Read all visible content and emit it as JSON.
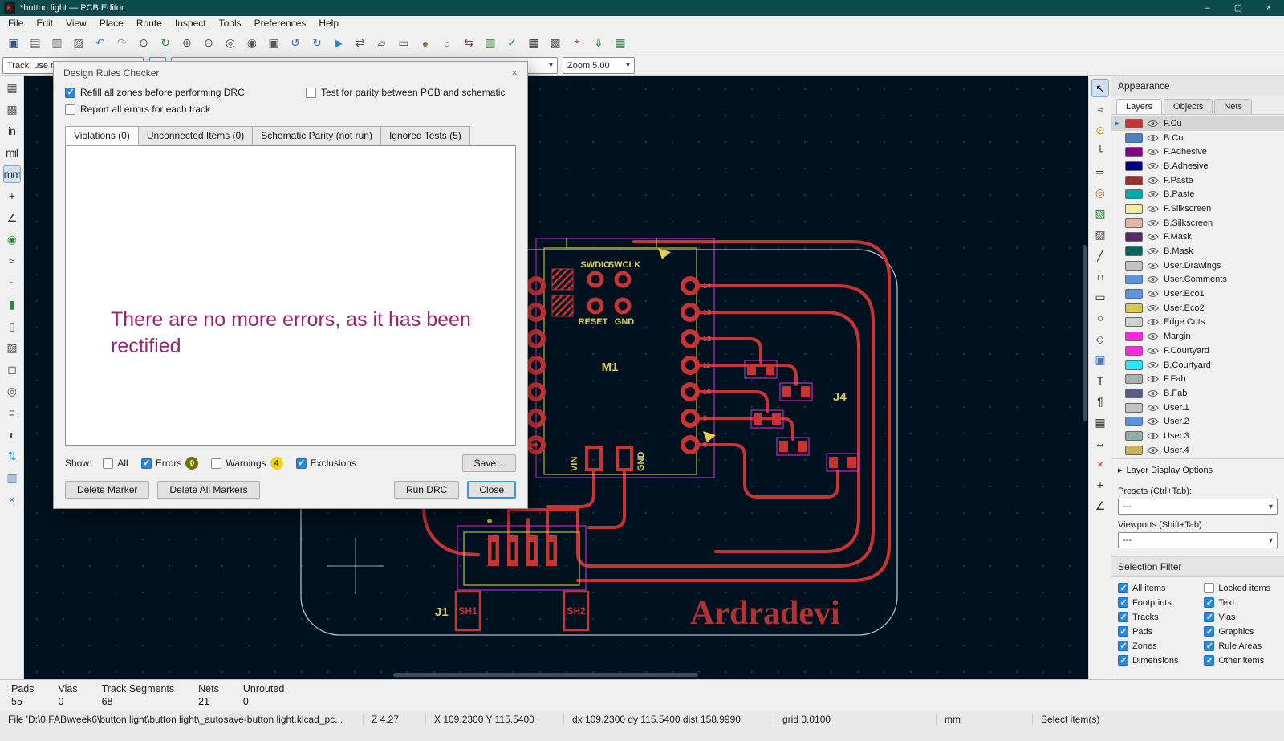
{
  "ui": {
    "combo_arrow": "▾",
    "expander": "▸",
    "active_arrow": "▶"
  },
  "window": {
    "title": "*button light — PCB Editor",
    "icon_glyph": "K",
    "minimize": "–",
    "maximize": "▢",
    "close": "×"
  },
  "menu": [
    {
      "name": "menu-file",
      "label": "File"
    },
    {
      "name": "menu-edit",
      "label": "Edit"
    },
    {
      "name": "menu-view",
      "label": "View"
    },
    {
      "name": "menu-place",
      "label": "Place"
    },
    {
      "name": "menu-route",
      "label": "Route"
    },
    {
      "name": "menu-inspect",
      "label": "Inspect"
    },
    {
      "name": "menu-tools",
      "label": "Tools"
    },
    {
      "name": "menu-preferences",
      "label": "Preferences"
    },
    {
      "name": "menu-help",
      "label": "Help"
    }
  ],
  "toolbar_top": [
    {
      "name": "save-icon",
      "glyph": "▣",
      "color": "#34538c"
    },
    {
      "name": "page-settings-icon",
      "glyph": "▤",
      "color": "#666666"
    },
    {
      "name": "print-icon",
      "glyph": "▥",
      "color": "#666666"
    },
    {
      "name": "plot-icon",
      "glyph": "▨",
      "color": "#666666"
    },
    {
      "name": "undo-icon",
      "glyph": "↶",
      "color": "#2e6fc4"
    },
    {
      "name": "redo-icon",
      "glyph": "↷",
      "color": "#9a9a9a"
    },
    {
      "name": "find-icon",
      "glyph": "⊙",
      "color": "#555555"
    },
    {
      "name": "refresh-icon",
      "glyph": "↻",
      "color": "#2a8a3a"
    },
    {
      "name": "zoom-in-icon",
      "glyph": "⊕",
      "color": "#555555"
    },
    {
      "name": "zoom-out-icon",
      "glyph": "⊖",
      "color": "#555555"
    },
    {
      "name": "zoom-fit-icon",
      "glyph": "◎",
      "color": "#555555"
    },
    {
      "name": "zoom-objects-icon",
      "glyph": "◉",
      "color": "#555555"
    },
    {
      "name": "zoom-selection-icon",
      "glyph": "▣",
      "color": "#555555"
    },
    {
      "name": "rotate-ccw-icon",
      "glyph": "↺",
      "color": "#2e6fc4"
    },
    {
      "name": "rotate-cw-icon",
      "glyph": "↻",
      "color": "#2e6fc4"
    },
    {
      "name": "run-plot-icon",
      "glyph": "▶",
      "color": "#1e88c7"
    },
    {
      "name": "mirror-icon",
      "glyph": "⇄",
      "color": "#555555"
    },
    {
      "name": "group-icon",
      "glyph": "▱",
      "color": "#555555"
    },
    {
      "name": "ungroup-icon",
      "glyph": "▭",
      "color": "#555555"
    },
    {
      "name": "lock-icon",
      "glyph": "●",
      "color": "#8a7a30"
    },
    {
      "name": "unlock-icon",
      "glyph": "○",
      "color": "#8a7a30"
    },
    {
      "name": "update-pcb-from-schematic-icon",
      "glyph": "⇆",
      "color": "#b03030"
    },
    {
      "name": "footprint-editor-icon",
      "glyph": "▥",
      "color": "#2a8a3a"
    },
    {
      "name": "drc-icon",
      "glyph": "✓",
      "color": "#2a8a3a"
    },
    {
      "name": "net-inspector-icon",
      "glyph": "▦",
      "color": "#333333"
    },
    {
      "name": "settings-icon",
      "glyph": "▩",
      "color": "#555555"
    },
    {
      "name": "plugins-icon",
      "glyph": "*",
      "color": "#b03030"
    },
    {
      "name": "update-plugins-icon",
      "glyph": "⇓",
      "color": "#2a8a3a"
    },
    {
      "name": "grid-properties-icon",
      "glyph": "▦",
      "color": "#2a8a3a"
    }
  ],
  "toolbar_row2": {
    "track_combo": "Track: use netclass widths",
    "grid_combo": "",
    "zoom_combo": "Zoom 5.00"
  },
  "left_toolbar": [
    {
      "name": "grid-visibility-icon",
      "glyph": "▦",
      "color": "#555555"
    },
    {
      "name": "grid-override-icon",
      "glyph": "▩",
      "color": "#555555"
    },
    {
      "name": "unit-inches-button",
      "glyph": "in",
      "color": "#333333"
    },
    {
      "name": "unit-mils-button",
      "glyph": "mil",
      "color": "#333333"
    },
    {
      "name": "unit-mm-button",
      "glyph": "mm",
      "color": "#333333",
      "active": true
    },
    {
      "name": "cursor-shape-icon",
      "glyph": "+",
      "color": "#333333"
    },
    {
      "name": "polar-coords-icon",
      "glyph": "∠",
      "color": "#333333"
    },
    {
      "name": "magnetic-pads-icon",
      "glyph": "◉",
      "color": "#2a8a3a"
    },
    {
      "name": "magnetic-tracks-icon",
      "glyph": "≈",
      "color": "#555555"
    },
    {
      "name": "ratsnest-icon",
      "glyph": "~",
      "color": "#4a7ac0"
    },
    {
      "name": "zone-fill-icon",
      "glyph": "▮",
      "color": "#2a8a3a"
    },
    {
      "name": "zone-outline-icon",
      "glyph": "▯",
      "color": "#555555"
    },
    {
      "name": "zone-fracture-icon",
      "glyph": "▨",
      "color": "#555555"
    },
    {
      "name": "pads-outline-icon",
      "glyph": "◻",
      "color": "#555555"
    },
    {
      "name": "vias-outline-icon",
      "glyph": "◎",
      "color": "#555555"
    },
    {
      "name": "tracks-outline-icon",
      "glyph": "≡",
      "color": "#555555"
    },
    {
      "name": "high-contrast-icon",
      "glyph": "◐",
      "color": "#333333"
    },
    {
      "name": "flip-board-icon",
      "glyph": "⇅",
      "color": "#1e9ac7"
    },
    {
      "name": "layers-manager-icon",
      "glyph": "▥",
      "color": "#4a7ac0"
    },
    {
      "name": "scripting-console-icon",
      "glyph": "×",
      "color": "#2e6fc4"
    }
  ],
  "right_toolbar": [
    {
      "name": "select-tool-icon",
      "glyph": "↖",
      "color": "#111111",
      "active": true
    },
    {
      "name": "local-ratsnest-icon",
      "glyph": "≈",
      "color": "#555555"
    },
    {
      "name": "highlight-net-icon",
      "glyph": "⊙",
      "color": "#c79a1e"
    },
    {
      "name": "route-tracks-icon",
      "glyph": "└",
      "color": "#333333"
    },
    {
      "name": "route-diff-pair-icon",
      "glyph": "═",
      "color": "#333333"
    },
    {
      "name": "via-icon",
      "glyph": "◎",
      "color": "#c7641e"
    },
    {
      "name": "add-zone-icon",
      "glyph": "▧",
      "color": "#2a8a3a"
    },
    {
      "name": "rule-area-icon",
      "glyph": "▨",
      "color": "#555555"
    },
    {
      "name": "line-tool-icon",
      "glyph": "╱",
      "color": "#333333"
    },
    {
      "name": "arc-tool-icon",
      "glyph": "∩",
      "color": "#333333"
    },
    {
      "name": "rectangle-tool-icon",
      "glyph": "▭",
      "color": "#333333"
    },
    {
      "name": "circle-tool-icon",
      "glyph": "○",
      "color": "#333333"
    },
    {
      "name": "polygon-tool-icon",
      "glyph": "◇",
      "color": "#333333"
    },
    {
      "name": "image-tool-icon",
      "glyph": "▣",
      "color": "#4a7ac0"
    },
    {
      "name": "text-tool-icon",
      "glyph": "T",
      "color": "#333333"
    },
    {
      "name": "textbox-tool-icon",
      "glyph": "¶",
      "color": "#333333"
    },
    {
      "name": "table-tool-icon",
      "glyph": "▦",
      "color": "#333333"
    },
    {
      "name": "dimension-tool-icon",
      "glyph": "↔",
      "color": "#333333"
    },
    {
      "name": "delete-tool-icon",
      "glyph": "×",
      "color": "#c03030"
    },
    {
      "name": "origin-tool-icon",
      "glyph": "+",
      "color": "#333333"
    },
    {
      "name": "measure-tool-icon",
      "glyph": "∠",
      "color": "#333333"
    }
  ],
  "drc": {
    "title": "Design Rules Checker",
    "close_glyph": "×",
    "opt_refill": {
      "label": "Refill all zones before performing DRC",
      "checked": true
    },
    "opt_parity": {
      "label": "Test for parity between PCB and schematic",
      "checked": false
    },
    "opt_report": {
      "label": "Report all errors for each track",
      "checked": false
    },
    "tabs": [
      {
        "name": "tab-violations",
        "label": "Violations (0)",
        "active": true
      },
      {
        "name": "tab-unconnected",
        "label": "Unconnected Items (0)"
      },
      {
        "name": "tab-schematic-parity",
        "label": "Schematic Parity (not run)"
      },
      {
        "name": "tab-ignored-tests",
        "label": "Ignored Tests (5)"
      }
    ],
    "annotation": "There are no more errors, as it has been rectified",
    "show_label": "Show:",
    "filters": [
      {
        "name": "filter-all",
        "label": "All",
        "checked": false
      },
      {
        "name": "filter-errors",
        "label": "Errors",
        "checked": true,
        "badge": "0",
        "badge_bg": "#6f7400",
        "badge_fg": "#ffffff"
      },
      {
        "name": "filter-warnings",
        "label": "Warnings",
        "checked": false,
        "badge": "4",
        "badge_bg": "#f4d410",
        "badge_fg": "#333333"
      },
      {
        "name": "filter-exclusions",
        "label": "Exclusions",
        "checked": true
      }
    ],
    "save_button": "Save...",
    "delete_marker": "Delete Marker",
    "delete_all": "Delete All Markers",
    "run_drc": "Run DRC",
    "close": "Close"
  },
  "appearance": {
    "title": "Appearance",
    "tabs": [
      {
        "name": "appearance-tab-layers",
        "label": "Layers",
        "active": true
      },
      {
        "name": "appearance-tab-objects",
        "label": "Objects"
      },
      {
        "name": "appearance-tab-nets",
        "label": "Nets"
      }
    ],
    "layers": [
      {
        "name": "layer-row-f-cu",
        "label": "F.Cu",
        "color": "#C83434",
        "selected": true
      },
      {
        "name": "layer-row-b-cu",
        "label": "B.Cu",
        "color": "#4D7FC4"
      },
      {
        "name": "layer-row-f-adhesive",
        "label": "F.Adhesive",
        "color": "#840084"
      },
      {
        "name": "layer-row-b-adhesive",
        "label": "B.Adhesive",
        "color": "#000084"
      },
      {
        "name": "layer-row-f-paste",
        "label": "F.Paste",
        "color": "#9C3030"
      },
      {
        "name": "layer-row-b-paste",
        "label": "B.Paste",
        "color": "#00AAAA"
      },
      {
        "name": "layer-row-f-silkscreen",
        "label": "F.Silkscreen",
        "color": "#F2EDA1"
      },
      {
        "name": "layer-row-b-silkscreen",
        "label": "B.Silkscreen",
        "color": "#E8B2A7"
      },
      {
        "name": "layer-row-f-mask",
        "label": "F.Mask",
        "color": "#562866"
      },
      {
        "name": "layer-row-b-mask",
        "label": "B.Mask",
        "color": "#01665F"
      },
      {
        "name": "layer-row-user-drawings",
        "label": "User.Drawings",
        "color": "#C2C2C2"
      },
      {
        "name": "layer-row-user-comments",
        "label": "User.Comments",
        "color": "#5994DC"
      },
      {
        "name": "layer-row-user-eco1",
        "label": "User.Eco1",
        "color": "#5994DC"
      },
      {
        "name": "layer-row-user-eco2",
        "label": "User.Eco2",
        "color": "#D8C852"
      },
      {
        "name": "layer-row-edge-cuts",
        "label": "Edge.Cuts",
        "color": "#D0D2CD"
      },
      {
        "name": "layer-row-margin",
        "label": "Margin",
        "color": "#FF26E2"
      },
      {
        "name": "layer-row-f-courtyard",
        "label": "F.Courtyard",
        "color": "#FF26E2"
      },
      {
        "name": "layer-row-b-courtyard",
        "label": "B.Courtyard",
        "color": "#26E9FF"
      },
      {
        "name": "layer-row-f-fab",
        "label": "F.Fab",
        "color": "#AFAFAF"
      },
      {
        "name": "layer-row-b-fab",
        "label": "B.Fab",
        "color": "#585D84"
      },
      {
        "name": "layer-row-user-1",
        "label": "User.1",
        "color": "#C2C2C2"
      },
      {
        "name": "layer-row-user-2",
        "label": "User.2",
        "color": "#5994DC"
      },
      {
        "name": "layer-row-user-3",
        "label": "User.3",
        "color": "#8FB0A8"
      },
      {
        "name": "layer-row-user-4",
        "label": "User.4",
        "color": "#C8B454"
      }
    ],
    "layer_display_options": "Layer Display Options",
    "presets_label": "Presets (Ctrl+Tab):",
    "presets_value": "---",
    "viewports_label": "Viewports (Shift+Tab):",
    "viewports_value": "---"
  },
  "selection_filter": {
    "title": "Selection Filter",
    "items": [
      {
        "name": "filter-all-items",
        "label": "All items",
        "checked": true
      },
      {
        "name": "filter-locked-items",
        "label": "Locked items",
        "checked": false
      },
      {
        "name": "filter-footprints",
        "label": "Footprints",
        "checked": true
      },
      {
        "name": "filter-text",
        "label": "Text",
        "checked": true
      },
      {
        "name": "filter-tracks",
        "label": "Tracks",
        "checked": true
      },
      {
        "name": "filter-vias",
        "label": "Vias",
        "checked": true
      },
      {
        "name": "filter-pads",
        "label": "Pads",
        "checked": true
      },
      {
        "name": "filter-graphics",
        "label": "Graphics",
        "checked": true
      },
      {
        "name": "filter-zones",
        "label": "Zones",
        "checked": true
      },
      {
        "name": "filter-rule-areas",
        "label": "Rule Areas",
        "checked": true
      },
      {
        "name": "filter-dimensions",
        "label": "Dimensions",
        "checked": true
      },
      {
        "name": "filter-other-items",
        "label": "Other items",
        "checked": true
      }
    ]
  },
  "stats": [
    {
      "label": "Pads",
      "value": "55"
    },
    {
      "label": "Vias",
      "value": "0"
    },
    {
      "label": "Track Segments",
      "value": "68"
    },
    {
      "label": "Nets",
      "value": "21"
    },
    {
      "label": "Unrouted",
      "value": "0"
    }
  ],
  "status": {
    "file": "File 'D:\\0 FAB\\week6\\button light\\button light\\_autosave-button light.kicad_pc...",
    "zoom": "Z 4.27",
    "pos": "X 109.2300  Y 115.5400",
    "delta": "dx 109.2300  dy 115.5400  dist 158.9990",
    "grid": "grid 0.0100",
    "units": "mm",
    "mode": "Select item(s)"
  },
  "canvas": {
    "labels": {
      "swdio": "SWDIO",
      "swclk": "SWCLK",
      "reset": "RESET",
      "gnd": "GND",
      "m1": "M1",
      "vin": "VIN",
      "gnd2": "GND",
      "j4": "J4",
      "j1": "J1",
      "sh1": "SH1",
      "sh2": "SH2",
      "brand": "Ardradevi"
    },
    "pins": [
      "14",
      "13",
      "12",
      "11",
      "10",
      "9",
      "8"
    ]
  }
}
